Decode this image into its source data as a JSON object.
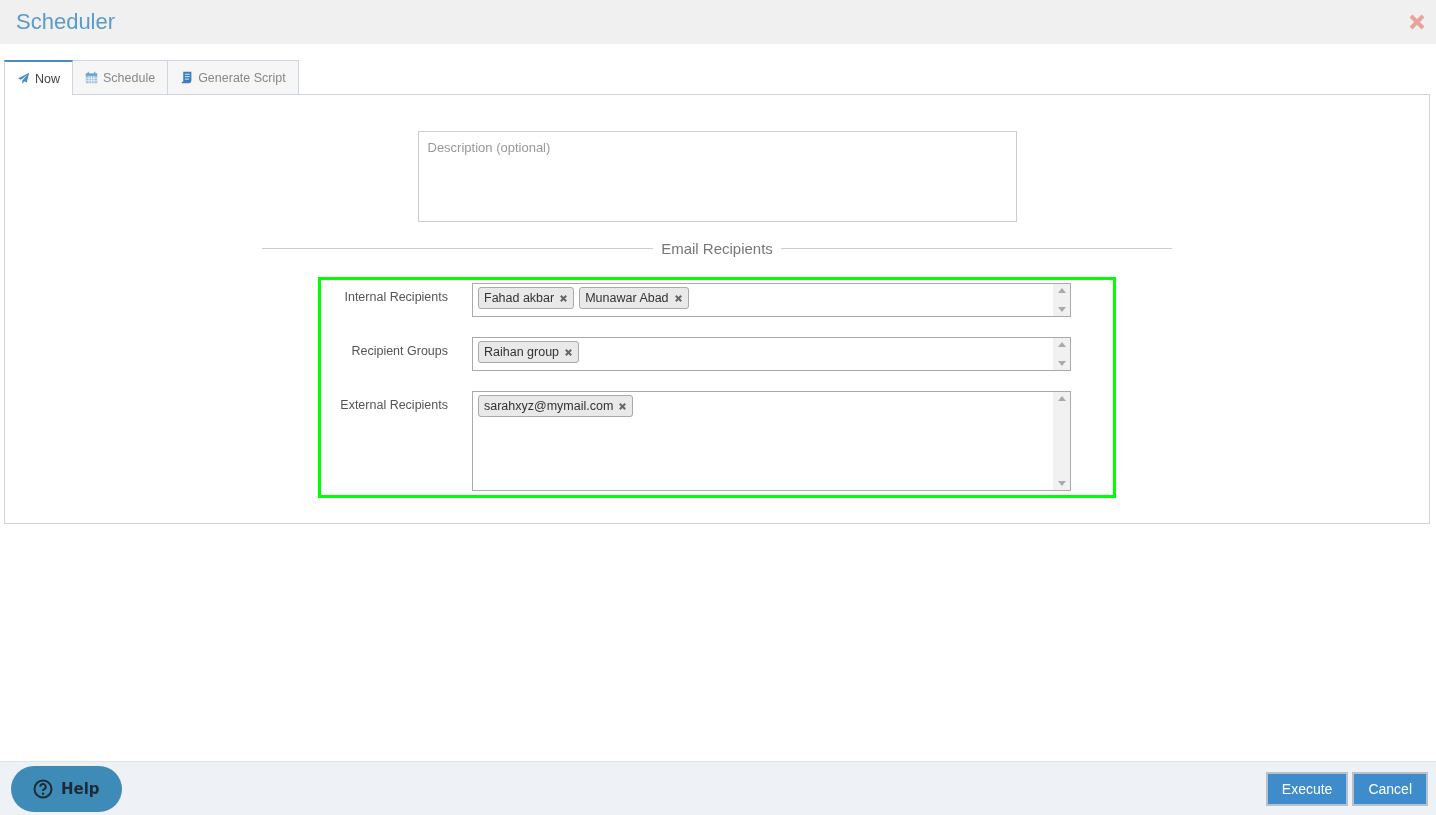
{
  "window": {
    "title": "Scheduler"
  },
  "tabs": [
    {
      "label": "Now",
      "kind": "plane",
      "selected": true
    },
    {
      "label": "Schedule",
      "kind": "calendar",
      "selected": false
    },
    {
      "label": "Generate Script",
      "kind": "scroll",
      "selected": false
    }
  ],
  "description": {
    "placeholder": "Description (optional)"
  },
  "section_title": "Email Recipients",
  "recipients_highlighted": true,
  "fields": [
    {
      "label": "Internal Recipients",
      "kind": "short",
      "tags": [
        "Fahad akbar",
        "Munawar Abad"
      ]
    },
    {
      "label": "Recipient Groups",
      "kind": "short",
      "tags": [
        "Raihan group"
      ]
    },
    {
      "label": "External Recipients",
      "kind": "tall",
      "tags": [
        "sarahxyz@mymail.com"
      ]
    }
  ],
  "help_button": "Help",
  "buttons": [
    "Execute",
    "Cancel"
  ]
}
